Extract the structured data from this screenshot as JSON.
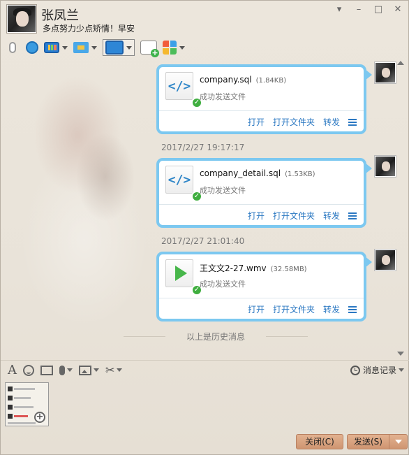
{
  "contact": {
    "name": "张凤兰",
    "signature": "多点努力少点矫情！早安"
  },
  "toolbar": {
    "icons": [
      "mic-icon",
      "webcam-icon",
      "screen-share-icon",
      "send-file-icon",
      "remote-desktop-icon",
      "create-group-chat-icon",
      "apps-icon"
    ]
  },
  "messages": [
    {
      "timestamp": "",
      "file_name": "company.sql",
      "file_size": "(1.84KB)",
      "status": "成功发送文件",
      "icon": "code-file-icon"
    },
    {
      "timestamp": "2017/2/27 19:17:17",
      "file_name": "company_detail.sql",
      "file_size": "(1.53KB)",
      "status": "成功发送文件",
      "icon": "code-file-icon"
    },
    {
      "timestamp": "2017/2/27 21:01:40",
      "file_name": "王文文2-27.wmv",
      "file_size": "(32.58MB)",
      "status": "成功发送文件",
      "icon": "video-file-icon"
    }
  ],
  "actions": {
    "open": "打开",
    "open_folder": "打开文件夹",
    "forward": "转发"
  },
  "history_divider": "以上是历史消息",
  "input_toolbar": {
    "history_label": "消息记录"
  },
  "buttons": {
    "close": "关闭(C)",
    "send": "发送(S)"
  },
  "colors": {
    "bubble_border": "#7cc8f0",
    "action_link": "#2b78c2",
    "button": "#d9a380"
  }
}
